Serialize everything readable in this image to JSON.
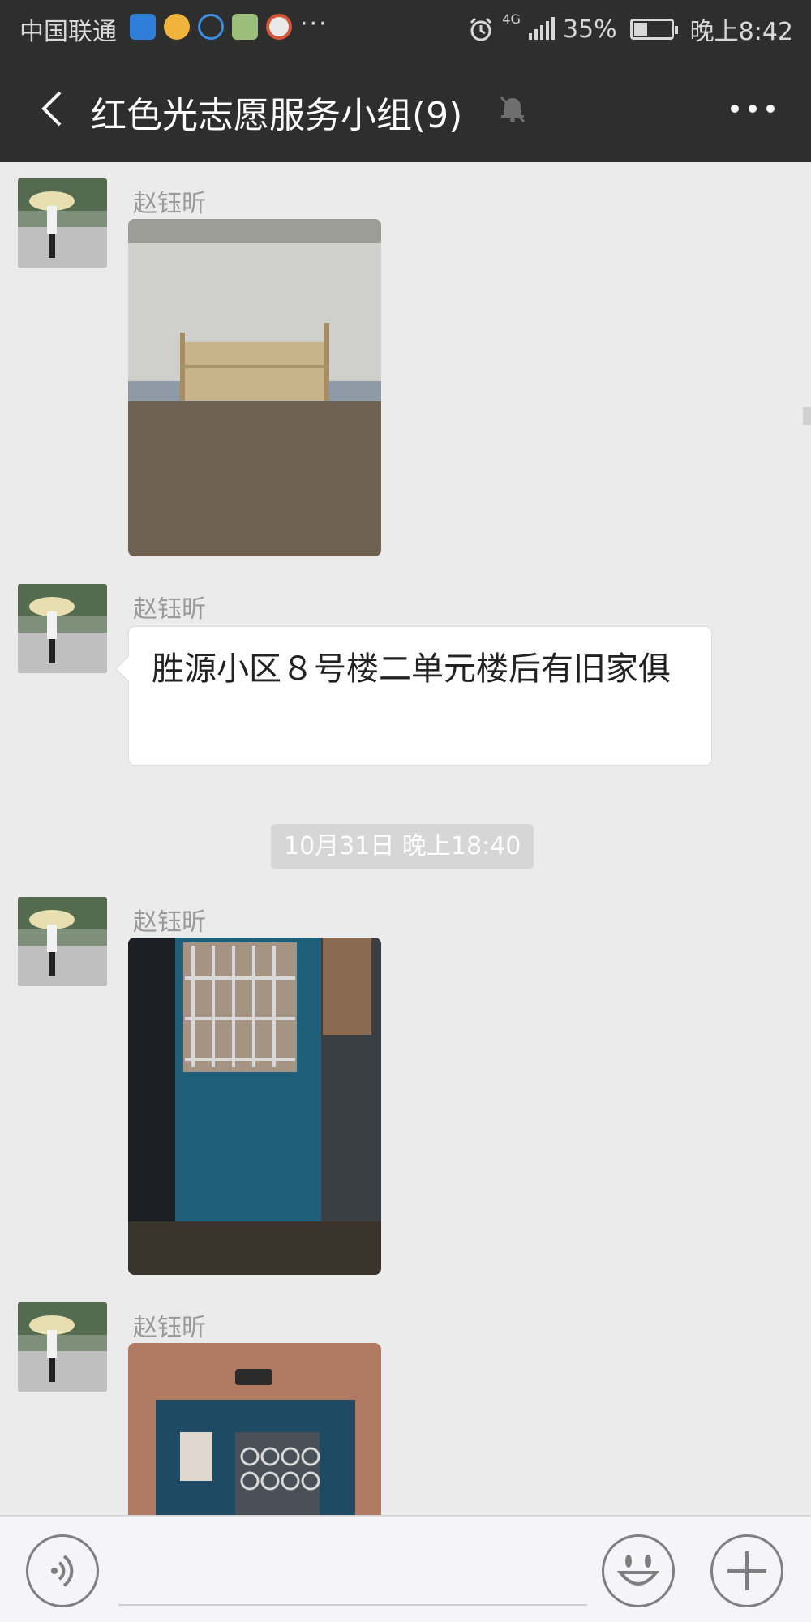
{
  "status_bar": {
    "carrier": "中国联通",
    "more_indicator": "···",
    "network": "4G",
    "battery": "35%",
    "battery_level": 0.35,
    "time": "晚上8:42",
    "icons": [
      "shield-icon",
      "mail-icon",
      "headset-icon",
      "app-icon",
      "browser-icon",
      "alarm-icon",
      "signal-icon",
      "battery-icon"
    ]
  },
  "header": {
    "title": "红色光志愿服务小组(9)",
    "icons": [
      "back-chevron-icon",
      "mute-bell-icon",
      "more-dots-icon"
    ]
  },
  "messages": [
    {
      "sender": "赵钰昕",
      "type": "image",
      "content": "furniture-by-wall-photo"
    },
    {
      "sender": "赵钰昕",
      "type": "text",
      "content": "胜源小区８号楼二单元楼后有旧家俱"
    },
    {
      "type": "timestamp",
      "content": "10月31日 晚上18:40"
    },
    {
      "sender": "赵钰昕",
      "type": "image",
      "content": "blue-door-photo"
    },
    {
      "sender": "赵钰昕",
      "type": "image",
      "content": "building-entrance-photo"
    }
  ],
  "input_bar": {
    "icons": [
      "voice-icon",
      "emoji-icon",
      "plus-icon"
    ]
  },
  "colors": {
    "header_bg": "#2e2e2e",
    "chat_bg": "#ebebeb",
    "bubble_bg": "#ffffff",
    "timestamp_bg": "#d6d6d6",
    "input_bg": "#f5f5f7"
  }
}
